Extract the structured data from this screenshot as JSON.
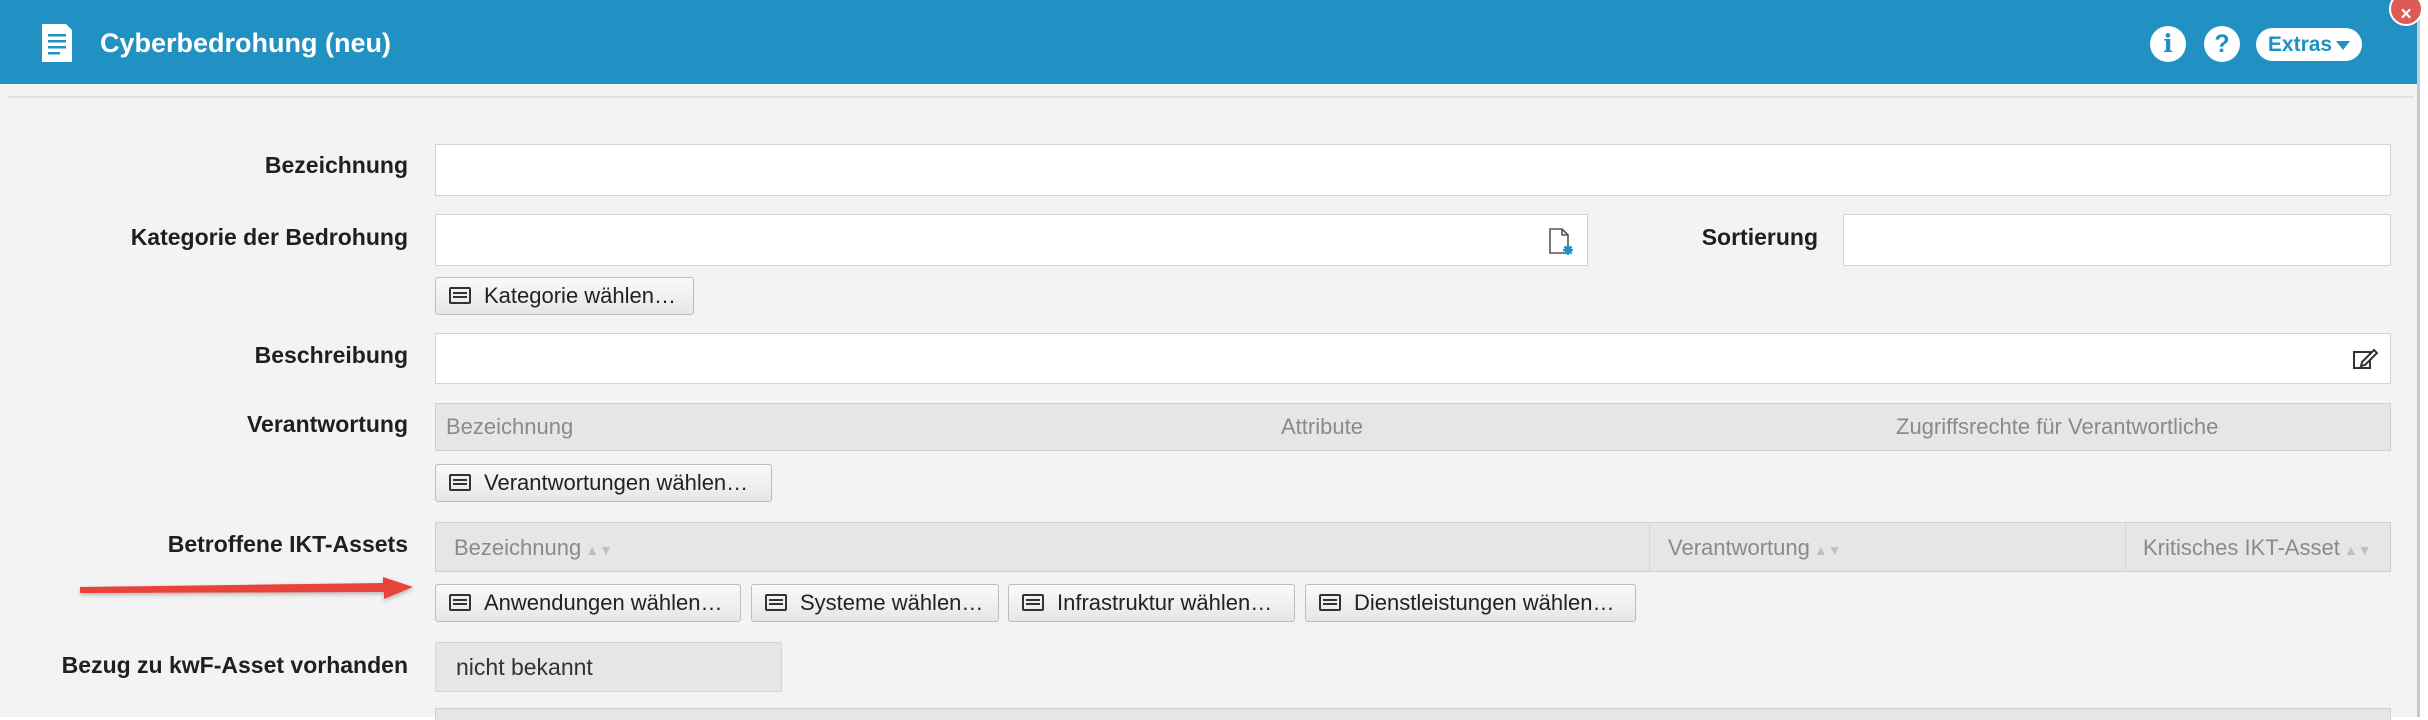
{
  "window": {
    "title": "Cyberbedrohung (neu)",
    "info_glyph": "i",
    "help_glyph": "?",
    "extras_label": "Extras",
    "close_glyph": "×",
    "accent_color": "#2191c4"
  },
  "form": {
    "bezeichnung_label": "Bezeichnung",
    "kategorie_label": "Kategorie der Bedrohung",
    "sortierung_label": "Sortierung",
    "kategorie_button": "Kategorie wählen…",
    "beschreibung_label": "Beschreibung",
    "verantwortung_label": "Verantwortung",
    "verantwortung_columns": [
      "Bezeichnung",
      "Attribute",
      "Zugriffsrechte für Verantwortliche"
    ],
    "verantwortung_button": "Verantwortungen wählen…",
    "assets_label": "Betroffene IKT-Assets",
    "assets_columns": [
      "Bezeichnung",
      "Verantwortung",
      "Kritisches IKT-Asset"
    ],
    "assets_buttons": [
      "Anwendungen wählen…",
      "Systeme wählen…",
      "Infrastruktur wählen…",
      "Dienstleistungen wählen…"
    ],
    "kwf_label": "Bezug zu kwF-Asset vorhanden",
    "kwf_value": "nicht bekannt"
  },
  "icons": {
    "title": "document-icon",
    "kategorie_field": "new-document-icon",
    "beschreibung_field": "edit-icon",
    "button": "list-icon",
    "annotation": "red-arrow"
  }
}
